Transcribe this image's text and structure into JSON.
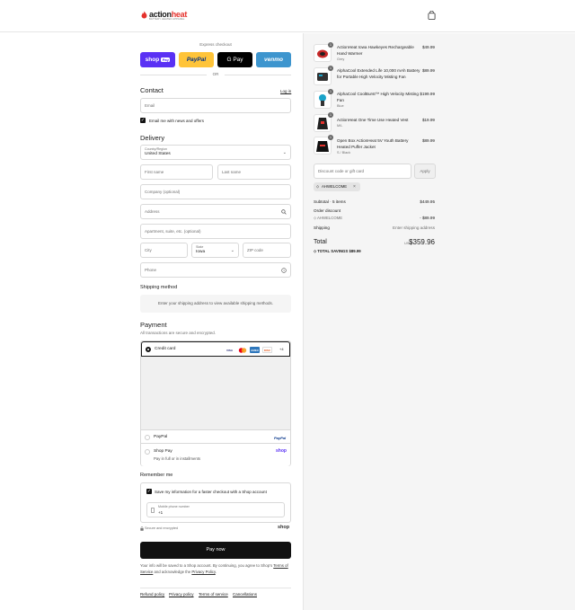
{
  "brand": {
    "name_prefix": "action",
    "name_suffix": "heat",
    "tagline": "BATTERY HEATED APPAREL",
    "accent_color": "#e5322d"
  },
  "header": {
    "cart_icon": "shopping-bag-icon"
  },
  "express": {
    "title": "Express checkout",
    "buttons": [
      {
        "label": "shop",
        "sub": "Pay",
        "bg": "#5a31f4",
        "color": "#ffffff"
      },
      {
        "label": "PayPal",
        "bg": "#ffc439",
        "color": "#003087"
      },
      {
        "label": "G Pay",
        "bg": "#000000",
        "color": "#ffffff"
      },
      {
        "label": "venmo",
        "bg": "#3d95ce",
        "color": "#ffffff"
      }
    ],
    "or": "OR"
  },
  "contact": {
    "title": "Contact",
    "login": "Log in",
    "email_placeholder": "Email",
    "newsletter_label": "Email me with news and offers"
  },
  "delivery": {
    "title": "Delivery",
    "country_label": "Country/Region",
    "country_value": "United States",
    "first_name": "First name",
    "last_name": "Last name",
    "company": "Company (optional)",
    "address": "Address",
    "apartment": "Apartment, suite, etc. (optional)",
    "city": "City",
    "state_label": "State",
    "state_value": "Iowa",
    "zip": "ZIP code",
    "phone": "Phone"
  },
  "shipping": {
    "title": "Shipping method",
    "notice": "Enter your shipping address to view available shipping methods."
  },
  "payment": {
    "title": "Payment",
    "subtitle": "All transactions are secure and encrypted.",
    "credit_card": "Credit card",
    "card_brands": [
      "VISA",
      "MC",
      "AMEX",
      "DISC"
    ],
    "more_cards": "+4",
    "paypal": "PayPal",
    "shop_pay": "Shop Pay",
    "shop_pay_sub": "Pay in full or in installments",
    "shop_word": "shop"
  },
  "remember": {
    "title": "Remember me",
    "checkbox_label": "Save my information for a faster checkout with a Shop account",
    "phone_label": "Mobile phone number",
    "phone_value": "+1",
    "secure": "Secure and encrypted",
    "shop_word": "shop"
  },
  "pay_now": "Pay now",
  "legal": {
    "text1": "Your info will be saved to a Shop account. By continuing, you agree to Shop's",
    "tos": "Terms of Service",
    "text2": "and acknowledge the",
    "privacy": "Privacy Policy",
    "end": "."
  },
  "footer_links": [
    "Refund policy",
    "Privacy policy",
    "Terms of service",
    "Cancellations"
  ],
  "items": [
    {
      "name": "ActionHeat Iowa Hawkeyes Rechargeable Hand Warmer",
      "variant": "Grey",
      "price": "$49.99",
      "qty": "1"
    },
    {
      "name": "AlphaCool Extended Life 10,000 mAh Battery for Portable High Velocity Misting Fan",
      "variant": "",
      "price": "$89.99",
      "qty": "1"
    },
    {
      "name": "AlphaCool CoolBurst™ High Velocity Misting Fan",
      "variant": "Blue",
      "price": "$199.99",
      "qty": "1"
    },
    {
      "name": "ActionHeat One Time Use Heated Vest",
      "variant": "M/L",
      "price": "$19.99",
      "qty": "1"
    },
    {
      "name": "Open Box ActionHeat 5V Youth Battery Heated Puffer Jacket",
      "variant": "S / Black",
      "price": "$89.99",
      "qty": "1"
    }
  ],
  "discount": {
    "placeholder": "Discount code or gift card",
    "apply": "Apply",
    "code": "AHWELCOME"
  },
  "summary": {
    "subtotal_label": "Subtotal · 5 items",
    "subtotal": "$449.95",
    "order_discount": "Order discount",
    "discount_code": "AHWELCOME",
    "discount_value": "- $89.99",
    "shipping_label": "Shipping",
    "shipping_value": "Enter shipping address",
    "total_label": "Total",
    "currency": "USD",
    "total": "$359.96",
    "savings_label": "TOTAL SAVINGS",
    "savings": "$89.99"
  }
}
